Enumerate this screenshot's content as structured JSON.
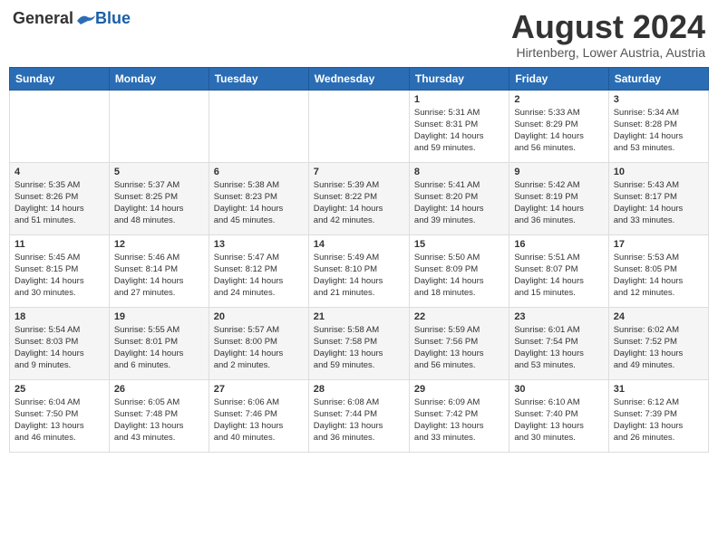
{
  "header": {
    "logo_general": "General",
    "logo_blue": "Blue",
    "month": "August 2024",
    "location": "Hirtenberg, Lower Austria, Austria"
  },
  "weekdays": [
    "Sunday",
    "Monday",
    "Tuesday",
    "Wednesday",
    "Thursday",
    "Friday",
    "Saturday"
  ],
  "weeks": [
    [
      {
        "day": "",
        "info": ""
      },
      {
        "day": "",
        "info": ""
      },
      {
        "day": "",
        "info": ""
      },
      {
        "day": "",
        "info": ""
      },
      {
        "day": "1",
        "info": "Sunrise: 5:31 AM\nSunset: 8:31 PM\nDaylight: 14 hours\nand 59 minutes."
      },
      {
        "day": "2",
        "info": "Sunrise: 5:33 AM\nSunset: 8:29 PM\nDaylight: 14 hours\nand 56 minutes."
      },
      {
        "day": "3",
        "info": "Sunrise: 5:34 AM\nSunset: 8:28 PM\nDaylight: 14 hours\nand 53 minutes."
      }
    ],
    [
      {
        "day": "4",
        "info": "Sunrise: 5:35 AM\nSunset: 8:26 PM\nDaylight: 14 hours\nand 51 minutes."
      },
      {
        "day": "5",
        "info": "Sunrise: 5:37 AM\nSunset: 8:25 PM\nDaylight: 14 hours\nand 48 minutes."
      },
      {
        "day": "6",
        "info": "Sunrise: 5:38 AM\nSunset: 8:23 PM\nDaylight: 14 hours\nand 45 minutes."
      },
      {
        "day": "7",
        "info": "Sunrise: 5:39 AM\nSunset: 8:22 PM\nDaylight: 14 hours\nand 42 minutes."
      },
      {
        "day": "8",
        "info": "Sunrise: 5:41 AM\nSunset: 8:20 PM\nDaylight: 14 hours\nand 39 minutes."
      },
      {
        "day": "9",
        "info": "Sunrise: 5:42 AM\nSunset: 8:19 PM\nDaylight: 14 hours\nand 36 minutes."
      },
      {
        "day": "10",
        "info": "Sunrise: 5:43 AM\nSunset: 8:17 PM\nDaylight: 14 hours\nand 33 minutes."
      }
    ],
    [
      {
        "day": "11",
        "info": "Sunrise: 5:45 AM\nSunset: 8:15 PM\nDaylight: 14 hours\nand 30 minutes."
      },
      {
        "day": "12",
        "info": "Sunrise: 5:46 AM\nSunset: 8:14 PM\nDaylight: 14 hours\nand 27 minutes."
      },
      {
        "day": "13",
        "info": "Sunrise: 5:47 AM\nSunset: 8:12 PM\nDaylight: 14 hours\nand 24 minutes."
      },
      {
        "day": "14",
        "info": "Sunrise: 5:49 AM\nSunset: 8:10 PM\nDaylight: 14 hours\nand 21 minutes."
      },
      {
        "day": "15",
        "info": "Sunrise: 5:50 AM\nSunset: 8:09 PM\nDaylight: 14 hours\nand 18 minutes."
      },
      {
        "day": "16",
        "info": "Sunrise: 5:51 AM\nSunset: 8:07 PM\nDaylight: 14 hours\nand 15 minutes."
      },
      {
        "day": "17",
        "info": "Sunrise: 5:53 AM\nSunset: 8:05 PM\nDaylight: 14 hours\nand 12 minutes."
      }
    ],
    [
      {
        "day": "18",
        "info": "Sunrise: 5:54 AM\nSunset: 8:03 PM\nDaylight: 14 hours\nand 9 minutes."
      },
      {
        "day": "19",
        "info": "Sunrise: 5:55 AM\nSunset: 8:01 PM\nDaylight: 14 hours\nand 6 minutes."
      },
      {
        "day": "20",
        "info": "Sunrise: 5:57 AM\nSunset: 8:00 PM\nDaylight: 14 hours\nand 2 minutes."
      },
      {
        "day": "21",
        "info": "Sunrise: 5:58 AM\nSunset: 7:58 PM\nDaylight: 13 hours\nand 59 minutes."
      },
      {
        "day": "22",
        "info": "Sunrise: 5:59 AM\nSunset: 7:56 PM\nDaylight: 13 hours\nand 56 minutes."
      },
      {
        "day": "23",
        "info": "Sunrise: 6:01 AM\nSunset: 7:54 PM\nDaylight: 13 hours\nand 53 minutes."
      },
      {
        "day": "24",
        "info": "Sunrise: 6:02 AM\nSunset: 7:52 PM\nDaylight: 13 hours\nand 49 minutes."
      }
    ],
    [
      {
        "day": "25",
        "info": "Sunrise: 6:04 AM\nSunset: 7:50 PM\nDaylight: 13 hours\nand 46 minutes."
      },
      {
        "day": "26",
        "info": "Sunrise: 6:05 AM\nSunset: 7:48 PM\nDaylight: 13 hours\nand 43 minutes."
      },
      {
        "day": "27",
        "info": "Sunrise: 6:06 AM\nSunset: 7:46 PM\nDaylight: 13 hours\nand 40 minutes."
      },
      {
        "day": "28",
        "info": "Sunrise: 6:08 AM\nSunset: 7:44 PM\nDaylight: 13 hours\nand 36 minutes."
      },
      {
        "day": "29",
        "info": "Sunrise: 6:09 AM\nSunset: 7:42 PM\nDaylight: 13 hours\nand 33 minutes."
      },
      {
        "day": "30",
        "info": "Sunrise: 6:10 AM\nSunset: 7:40 PM\nDaylight: 13 hours\nand 30 minutes."
      },
      {
        "day": "31",
        "info": "Sunrise: 6:12 AM\nSunset: 7:39 PM\nDaylight: 13 hours\nand 26 minutes."
      }
    ]
  ]
}
